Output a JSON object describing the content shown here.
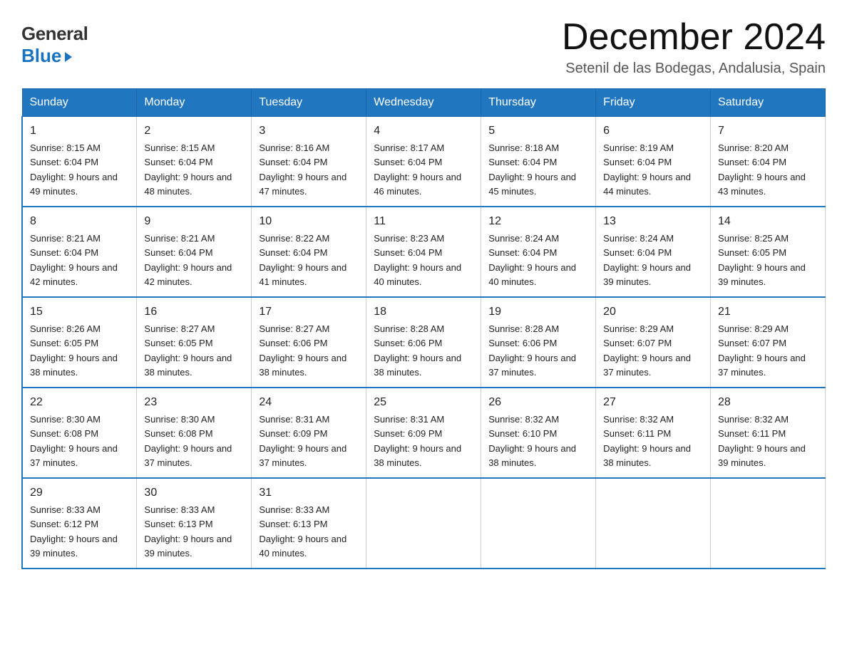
{
  "header": {
    "logo_general": "General",
    "logo_blue": "Blue",
    "main_title": "December 2024",
    "subtitle": "Setenil de las Bodegas, Andalusia, Spain"
  },
  "calendar": {
    "weekdays": [
      "Sunday",
      "Monday",
      "Tuesday",
      "Wednesday",
      "Thursday",
      "Friday",
      "Saturday"
    ],
    "weeks": [
      [
        {
          "day": "1",
          "sunrise": "8:15 AM",
          "sunset": "6:04 PM",
          "daylight": "9 hours and 49 minutes."
        },
        {
          "day": "2",
          "sunrise": "8:15 AM",
          "sunset": "6:04 PM",
          "daylight": "9 hours and 48 minutes."
        },
        {
          "day": "3",
          "sunrise": "8:16 AM",
          "sunset": "6:04 PM",
          "daylight": "9 hours and 47 minutes."
        },
        {
          "day": "4",
          "sunrise": "8:17 AM",
          "sunset": "6:04 PM",
          "daylight": "9 hours and 46 minutes."
        },
        {
          "day": "5",
          "sunrise": "8:18 AM",
          "sunset": "6:04 PM",
          "daylight": "9 hours and 45 minutes."
        },
        {
          "day": "6",
          "sunrise": "8:19 AM",
          "sunset": "6:04 PM",
          "daylight": "9 hours and 44 minutes."
        },
        {
          "day": "7",
          "sunrise": "8:20 AM",
          "sunset": "6:04 PM",
          "daylight": "9 hours and 43 minutes."
        }
      ],
      [
        {
          "day": "8",
          "sunrise": "8:21 AM",
          "sunset": "6:04 PM",
          "daylight": "9 hours and 42 minutes."
        },
        {
          "day": "9",
          "sunrise": "8:21 AM",
          "sunset": "6:04 PM",
          "daylight": "9 hours and 42 minutes."
        },
        {
          "day": "10",
          "sunrise": "8:22 AM",
          "sunset": "6:04 PM",
          "daylight": "9 hours and 41 minutes."
        },
        {
          "day": "11",
          "sunrise": "8:23 AM",
          "sunset": "6:04 PM",
          "daylight": "9 hours and 40 minutes."
        },
        {
          "day": "12",
          "sunrise": "8:24 AM",
          "sunset": "6:04 PM",
          "daylight": "9 hours and 40 minutes."
        },
        {
          "day": "13",
          "sunrise": "8:24 AM",
          "sunset": "6:04 PM",
          "daylight": "9 hours and 39 minutes."
        },
        {
          "day": "14",
          "sunrise": "8:25 AM",
          "sunset": "6:05 PM",
          "daylight": "9 hours and 39 minutes."
        }
      ],
      [
        {
          "day": "15",
          "sunrise": "8:26 AM",
          "sunset": "6:05 PM",
          "daylight": "9 hours and 38 minutes."
        },
        {
          "day": "16",
          "sunrise": "8:27 AM",
          "sunset": "6:05 PM",
          "daylight": "9 hours and 38 minutes."
        },
        {
          "day": "17",
          "sunrise": "8:27 AM",
          "sunset": "6:06 PM",
          "daylight": "9 hours and 38 minutes."
        },
        {
          "day": "18",
          "sunrise": "8:28 AM",
          "sunset": "6:06 PM",
          "daylight": "9 hours and 38 minutes."
        },
        {
          "day": "19",
          "sunrise": "8:28 AM",
          "sunset": "6:06 PM",
          "daylight": "9 hours and 37 minutes."
        },
        {
          "day": "20",
          "sunrise": "8:29 AM",
          "sunset": "6:07 PM",
          "daylight": "9 hours and 37 minutes."
        },
        {
          "day": "21",
          "sunrise": "8:29 AM",
          "sunset": "6:07 PM",
          "daylight": "9 hours and 37 minutes."
        }
      ],
      [
        {
          "day": "22",
          "sunrise": "8:30 AM",
          "sunset": "6:08 PM",
          "daylight": "9 hours and 37 minutes."
        },
        {
          "day": "23",
          "sunrise": "8:30 AM",
          "sunset": "6:08 PM",
          "daylight": "9 hours and 37 minutes."
        },
        {
          "day": "24",
          "sunrise": "8:31 AM",
          "sunset": "6:09 PM",
          "daylight": "9 hours and 37 minutes."
        },
        {
          "day": "25",
          "sunrise": "8:31 AM",
          "sunset": "6:09 PM",
          "daylight": "9 hours and 38 minutes."
        },
        {
          "day": "26",
          "sunrise": "8:32 AM",
          "sunset": "6:10 PM",
          "daylight": "9 hours and 38 minutes."
        },
        {
          "day": "27",
          "sunrise": "8:32 AM",
          "sunset": "6:11 PM",
          "daylight": "9 hours and 38 minutes."
        },
        {
          "day": "28",
          "sunrise": "8:32 AM",
          "sunset": "6:11 PM",
          "daylight": "9 hours and 39 minutes."
        }
      ],
      [
        {
          "day": "29",
          "sunrise": "8:33 AM",
          "sunset": "6:12 PM",
          "daylight": "9 hours and 39 minutes."
        },
        {
          "day": "30",
          "sunrise": "8:33 AM",
          "sunset": "6:13 PM",
          "daylight": "9 hours and 39 minutes."
        },
        {
          "day": "31",
          "sunrise": "8:33 AM",
          "sunset": "6:13 PM",
          "daylight": "9 hours and 40 minutes."
        },
        null,
        null,
        null,
        null
      ]
    ]
  }
}
